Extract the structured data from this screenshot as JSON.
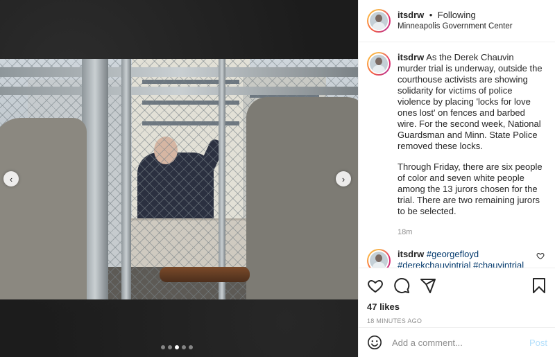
{
  "post": {
    "username": "itsdrw",
    "follow_status": "Following",
    "separator": "•",
    "location": "Minneapolis Government Center"
  },
  "caption": {
    "username": "itsdrw",
    "paragraph1": "As the Derek Chauvin murder trial is underway, outside the courthouse activists are showing solidarity for victims of police violence by placing 'locks for love ones lost' on fences and barbed wire. For the second week, National Guardsman and Minn. State Police removed these locks.",
    "paragraph2": "Through Friday, there are six people of color and seven white people among the 13 jurors chosen for the trial. There are two remaining jurors to be selected.",
    "time": "18m"
  },
  "tag_comment": {
    "username": "itsdrw",
    "hashtags": "#georgefloyd #derekchauvintrial #chauvintrial"
  },
  "engagement": {
    "likes": "47 likes",
    "posted_ago": "18 MINUTES AGO"
  },
  "comment_box": {
    "placeholder": "Add a comment...",
    "post_label": "Post"
  },
  "carousel": {
    "total_slides": 5,
    "active_slide": 3,
    "prev_icon": "chevron-left-icon",
    "next_icon": "chevron-right-icon"
  },
  "icons": [
    "heart-icon",
    "comment-icon",
    "share-icon",
    "bookmark-icon",
    "emoji-icon"
  ],
  "colors": {
    "link": "#00376b",
    "muted": "#8e8e8e",
    "post_disabled": "#b2dffc",
    "text": "#262626"
  }
}
